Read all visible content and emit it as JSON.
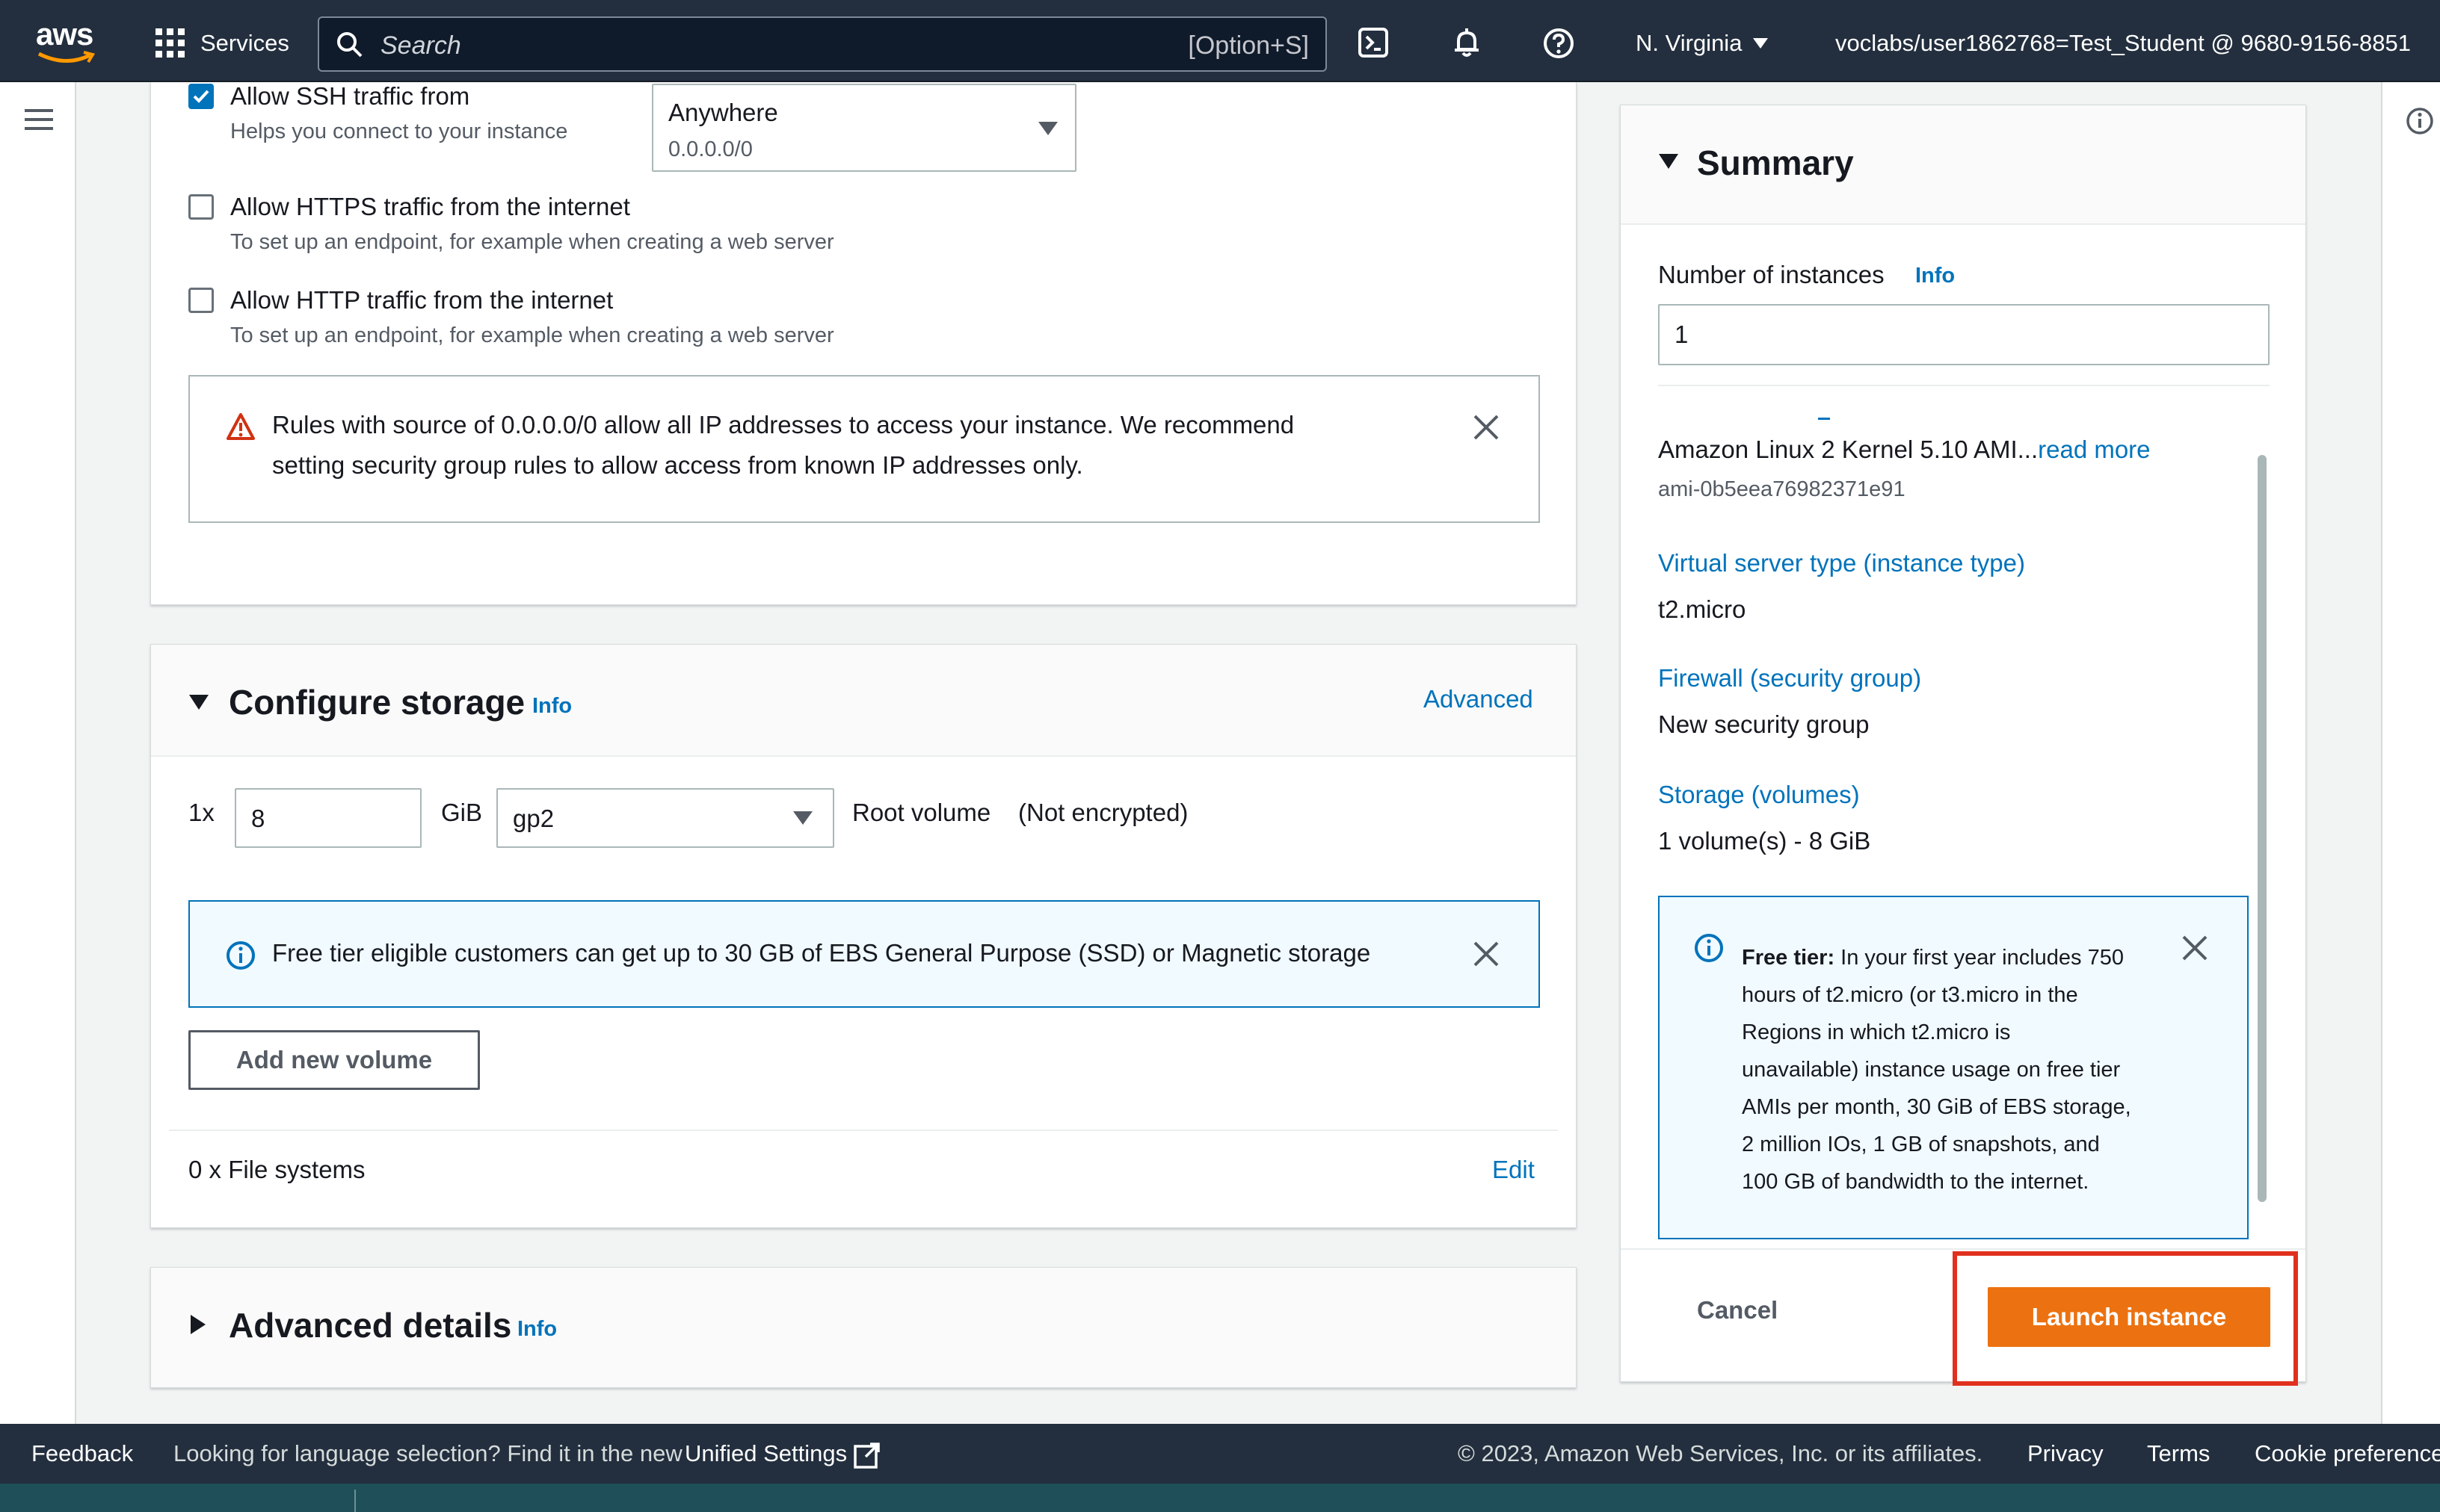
{
  "nav": {
    "logo": "aws",
    "services": "Services",
    "search_placeholder": "Search",
    "search_shortcut": "[Option+S]",
    "region": "N. Virginia",
    "account": "voclabs/user1862768=Test_Student @ 9680-9156-8851"
  },
  "network": {
    "ssh_label": "Allow SSH traffic from",
    "ssh_desc": "Helps you connect to your instance",
    "ssh_checked": true,
    "source_value": "Anywhere",
    "source_cidr": "0.0.0.0/0",
    "https_label": "Allow HTTPS traffic from the internet",
    "https_desc": "To set up an endpoint, for example when creating a web server",
    "http_label": "Allow HTTP traffic from the internet",
    "http_desc": "To set up an endpoint, for example when creating a web server",
    "warning_line1": "Rules with source of 0.0.0.0/0 allow all IP addresses to access your instance. We recommend",
    "warning_line2": "setting security group rules to allow access from known IP addresses only."
  },
  "storage": {
    "title": "Configure storage",
    "info": "Info",
    "advanced": "Advanced",
    "multiplier": "1x",
    "size": "8",
    "unit": "GiB",
    "volume_type": "gp2",
    "root_label": "Root volume",
    "encryption": "(Not encrypted)",
    "free_tier_note": "Free tier eligible customers can get up to 30 GB of EBS General Purpose (SSD) or Magnetic storage",
    "add_volume": "Add new volume",
    "file_systems": "0 x File systems",
    "edit": "Edit"
  },
  "advanced_details": {
    "title": "Advanced details",
    "info": "Info"
  },
  "summary": {
    "title": "Summary",
    "instances_label": "Number of instances",
    "info": "Info",
    "instances_value": "1",
    "ami_name": "Amazon Linux 2 Kernel 5.10 AMI...",
    "read_more": "read more",
    "ami_id": "ami-0b5eea76982371e91",
    "instance_type_label": "Virtual server type (instance type)",
    "instance_type_value": "t2.micro",
    "firewall_label": "Firewall (security group)",
    "firewall_value": "New security group",
    "storage_label": "Storage (volumes)",
    "storage_value": "1 volume(s) - 8 GiB",
    "free_tier_bold": "Free tier:",
    "free_tier_lines": [
      "In your first year includes 750",
      "hours of t2.micro (or t3.micro in the",
      "Regions in which t2.micro is",
      "unavailable) instance usage on free tier",
      "AMIs per month, 30 GiB of EBS storage,",
      "2 million IOs, 1 GB of snapshots, and",
      "100 GB of bandwidth to the internet."
    ],
    "cancel": "Cancel",
    "launch": "Launch instance"
  },
  "footer": {
    "feedback": "Feedback",
    "language_note": "Looking for language selection? Find it in the new",
    "unified_settings": "Unified Settings",
    "copyright": "© 2023, Amazon Web Services, Inc. or its affiliates.",
    "privacy": "Privacy",
    "terms": "Terms",
    "cookies": "Cookie preferences"
  },
  "colors": {
    "nav_bg": "#232f3e",
    "link": "#0073bb",
    "launch_orange": "#ec7211",
    "highlight_red": "#e0301e"
  }
}
